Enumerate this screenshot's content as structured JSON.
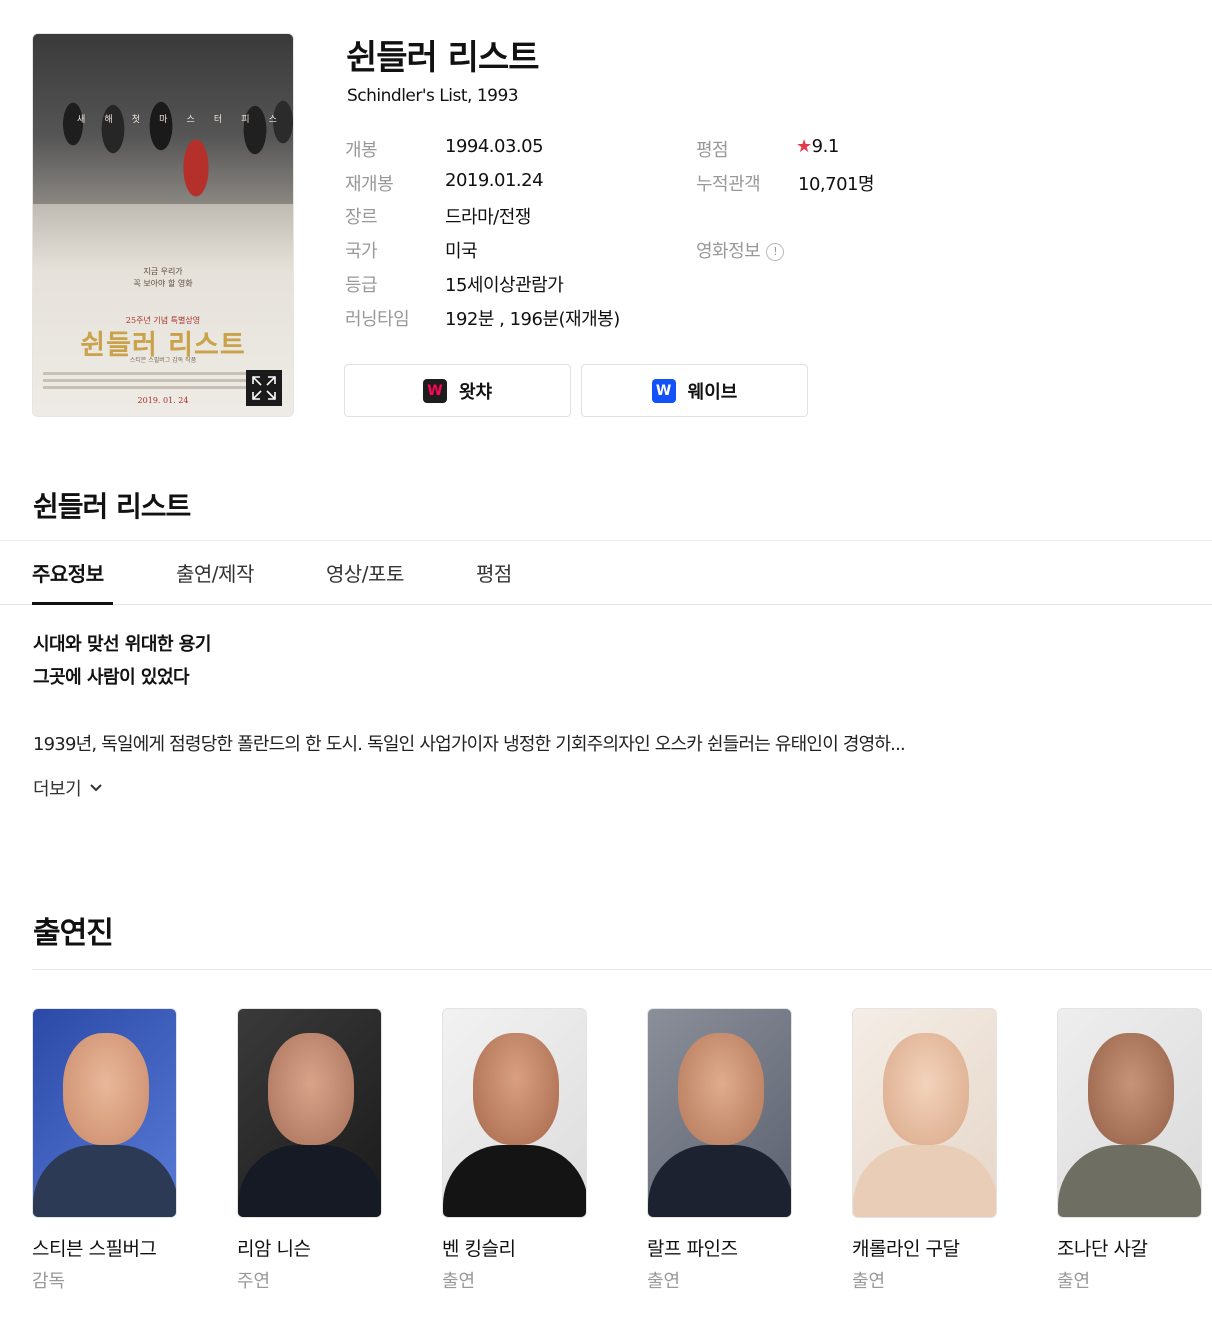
{
  "movie": {
    "title": "쉰들러 리스트",
    "subtitle": "Schindler's List, 1993",
    "poster": {
      "top_letters": [
        "새",
        "해",
        "첫",
        "마",
        "스",
        "터",
        "피",
        "스"
      ],
      "tagline_line1": "지금 우리가",
      "tagline_line2": "꼭 보아야 할 영화",
      "anniversary": "25주년 기념 특별상영",
      "title": "쉰들러 리스트",
      "credit": "스티븐 스필버그 감독 작품",
      "date": "2019. 01. 24",
      "expand_icon": "expand-icon"
    },
    "info_left": [
      {
        "label": "개봉",
        "value": "1994.03.05"
      },
      {
        "label": "재개봉",
        "value": "2019.01.24"
      },
      {
        "label": "장르",
        "value": "드라마/전쟁"
      },
      {
        "label": "국가",
        "value": "미국"
      },
      {
        "label": "등급",
        "value": "15세이상관람가"
      },
      {
        "label": "러닝타임",
        "value": "192분 , 196분(재개봉)"
      }
    ],
    "info_right": [
      {
        "label": "평점",
        "value": "9.1",
        "icon": "star-icon"
      },
      {
        "label": "누적관객",
        "value": "10,701명"
      },
      {
        "label": "영화정보",
        "icon": "info-icon",
        "icon_glyph": "!"
      }
    ]
  },
  "ott": [
    {
      "label": "왓챠",
      "logo": "W",
      "logo_color": "#ff0558"
    },
    {
      "label": "웨이브",
      "logo": "W",
      "logo_color": "#1351f9"
    }
  ],
  "section": {
    "title": "쉰들러 리스트",
    "tabs": [
      "주요정보",
      "출연/제작",
      "영상/포토",
      "평점"
    ]
  },
  "synopsis": {
    "tagline1": "시대와 맞선 위대한 용기",
    "tagline2": "그곳에 사람이 있었다",
    "text": "1939년, 독일에게 점령당한 폴란드의 한 도시. 독일인 사업가이자 냉정한 기회주의자인 오스카 쉰들러는 유태인이 경영하...",
    "more_label": "더보기"
  },
  "cast": {
    "title": "출연진",
    "members": [
      {
        "name": "스티븐 스필버그",
        "role": "감독"
      },
      {
        "name": "리암 니슨",
        "role": "주연"
      },
      {
        "name": "벤 킹슬리",
        "role": "출연"
      },
      {
        "name": "랄프 파인즈",
        "role": "출연"
      },
      {
        "name": "캐롤라인 구달",
        "role": "출연"
      },
      {
        "name": "조나단 사갈",
        "role": "출연"
      }
    ]
  },
  "colors": {
    "rating_star": "#e33b4b",
    "watcha": "#ff0558",
    "wavve": "#1351f9",
    "label_gray": "#999999"
  }
}
